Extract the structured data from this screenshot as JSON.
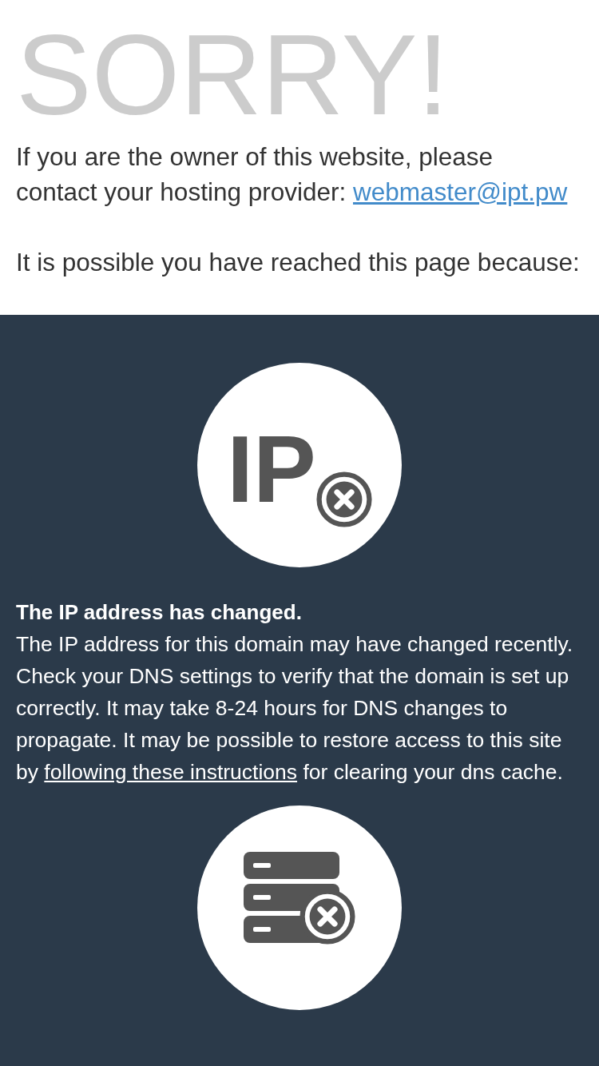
{
  "title": "SORRY!",
  "owner_note": {
    "text": "If you are the owner of this website, please contact your hosting provider: ",
    "link": "webmaster@ipt.pw"
  },
  "intro": "It is possible you have reached this page because:",
  "reasons": [
    {
      "kind": "ip",
      "icon_text": "IP",
      "heading": "The IP address has changed.",
      "before": "The IP address for this domain may have changed recently. Check your DNS settings to verify that the domain is set up correctly. It may take 8-24 hours for DNS changes to propagate. It may be possible to restore access to this site by ",
      "link": "following these instructions",
      "after": " for clearing your dns cache."
    },
    {
      "kind": "server"
    }
  ]
}
